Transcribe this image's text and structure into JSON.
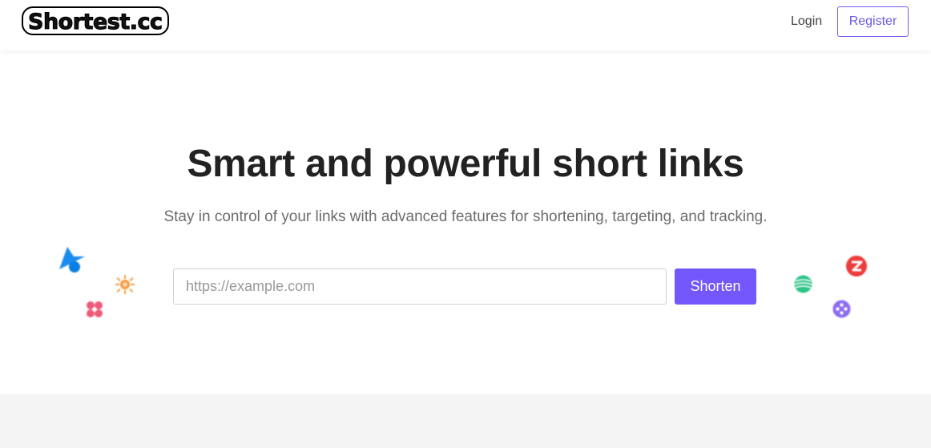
{
  "header": {
    "logo_text": "Shortest.cc",
    "login_label": "Login",
    "register_label": "Register"
  },
  "hero": {
    "title": "Smart and powerful short links",
    "subtitle": "Stay in control of your links with advanced features for shortening, targeting, and tracking.",
    "url_input": {
      "value": "",
      "placeholder": "https://example.com"
    },
    "shorten_label": "Shorten"
  },
  "decorations": [
    {
      "name": "blue-shape-icon",
      "color": "#1a8cf0"
    },
    {
      "name": "orange-sun-icon",
      "color": "#f39a3c"
    },
    {
      "name": "pink-flower-icon",
      "color": "#ee5b7a"
    },
    {
      "name": "green-globe-icon",
      "color": "#2ec486"
    },
    {
      "name": "red-zap-icon",
      "color": "#ee3b3b"
    },
    {
      "name": "purple-pinwheel-icon",
      "color": "#8c6cf0"
    }
  ],
  "colors": {
    "accent": "#7357fa",
    "register_border": "#6f5ef5",
    "bottom_band": "#f4f4f4"
  }
}
